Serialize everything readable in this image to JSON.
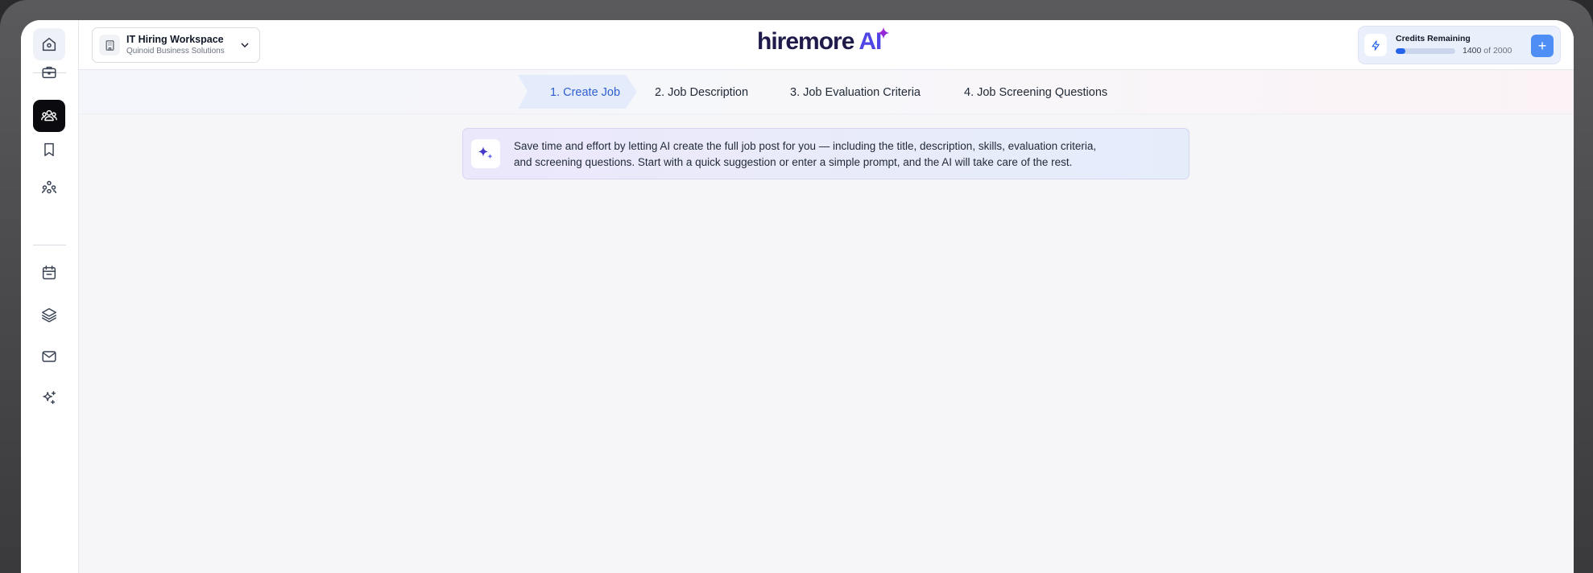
{
  "workspace": {
    "title": "IT Hiring Workspace",
    "subtitle": "Quinoid Business Solutions"
  },
  "logo": {
    "main": "hiremore",
    "ai": "AI"
  },
  "credits": {
    "title": "Credits Remaining",
    "used": "1400",
    "of": "of",
    "total": "2000",
    "fill_fraction": 0.16,
    "add_label": "+"
  },
  "steps": [
    {
      "label": "1. Create Job",
      "active": true
    },
    {
      "label": "2. Job Description",
      "active": false
    },
    {
      "label": "3. Job Evaluation Criteria",
      "active": false
    },
    {
      "label": "4. Job Screening Questions",
      "active": false
    }
  ],
  "banner": {
    "text_line1": "Save time and effort by letting AI create the full job post for you — including the title, description, skills, evaluation criteria,",
    "text_line2": "and screening questions. Start with a quick suggestion or enter a simple prompt, and the AI will take care of the rest."
  },
  "sidebar": {
    "icons": [
      "home-icon",
      "briefcase-icon",
      "users-icon",
      "bookmark-icon",
      "team-icon",
      "calendar-icon",
      "layers-icon",
      "mail-icon",
      "sparkles-icon"
    ]
  },
  "colors": {
    "accent": "#2563eb",
    "active_step": "#2f5fd0",
    "sidebar_active": "#0b0b0f",
    "logo_dark": "#1e1b4b",
    "logo_ai": "#4f46e5"
  }
}
